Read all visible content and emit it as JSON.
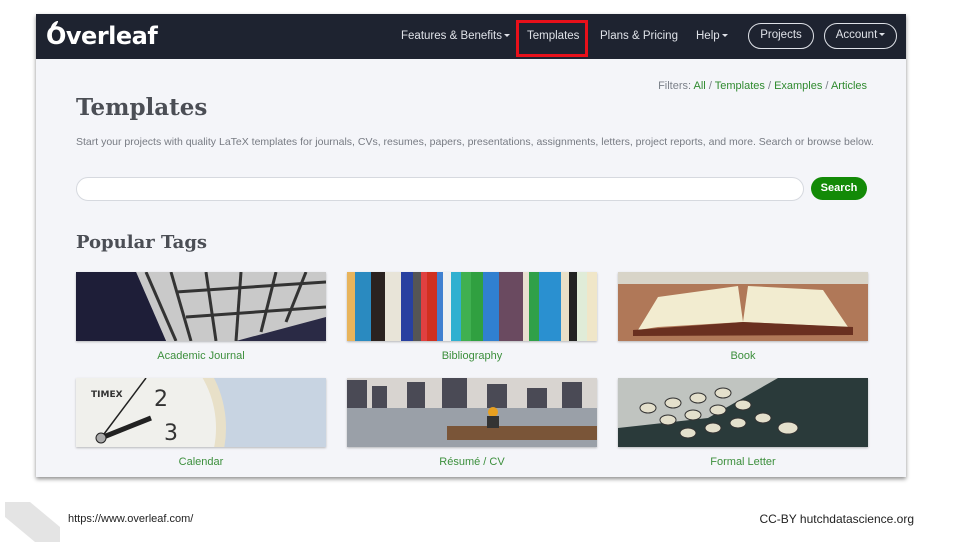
{
  "navbar": {
    "logo": "Overleaf",
    "items": [
      {
        "label": "Features & Benefits",
        "dropdown": true
      },
      {
        "label": "Templates",
        "dropdown": false,
        "highlighted": true
      },
      {
        "label": "Plans & Pricing",
        "dropdown": false
      },
      {
        "label": "Help",
        "dropdown": true
      }
    ],
    "projects_button": "Projects",
    "account_button": "Account",
    "highlight_color": "#e8101a"
  },
  "filters": {
    "prefix": "Filters:",
    "links": [
      "All",
      "Templates",
      "Examples",
      "Articles"
    ],
    "separator": "/"
  },
  "page": {
    "title": "Templates",
    "description": "Start your projects with quality LaTeX templates for journals, CVs, resumes, papers, presentations, assignments, letters, project reports, and more. Search or browse below.",
    "search_placeholder": "",
    "search_value": "",
    "search_button": "Search",
    "popular_tags_heading": "Popular Tags"
  },
  "tags": [
    {
      "label": "Academic Journal",
      "image": "library-shelves"
    },
    {
      "label": "Bibliography",
      "image": "book-spines"
    },
    {
      "label": "Book",
      "image": "open-book"
    },
    {
      "label": "Calendar",
      "image": "clock-face"
    },
    {
      "label": "Résumé / CV",
      "image": "city-bench"
    },
    {
      "label": "Formal Letter",
      "image": "typewriter"
    }
  ],
  "colors": {
    "navbar_bg": "#1e2330",
    "accent_green": "#138a07",
    "link_green": "#3c8f3c"
  },
  "footer": {
    "url": "https://www.overleaf.com/",
    "credit": "CC-BY hutchdatascience.org"
  }
}
